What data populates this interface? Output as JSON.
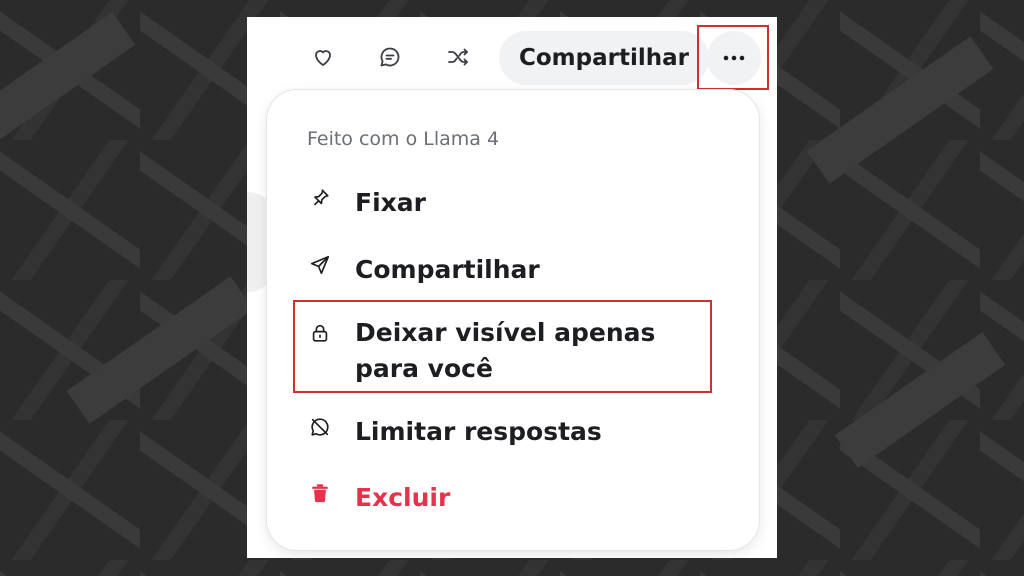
{
  "toolbar": {
    "icons": [
      "heart-icon",
      "comment-icon",
      "shuffle-icon"
    ],
    "share_label": "Compartilhar",
    "more_icon": "ellipsis-icon"
  },
  "menu": {
    "caption": "Feito com o Llama 4",
    "items": [
      {
        "label": "Fixar",
        "icon": "pin-icon"
      },
      {
        "label": "Compartilhar",
        "icon": "send-icon"
      },
      {
        "label": "Deixar visível apenas para você",
        "icon": "lock-icon"
      },
      {
        "label": "Limitar respostas",
        "icon": "comment-off-icon"
      },
      {
        "label": "Excluir",
        "icon": "trash-icon"
      }
    ]
  },
  "colors": {
    "danger": "#e5334b",
    "highlight": "#d0302e",
    "pill_bg": "#f1f2f4",
    "text": "#1c1e21",
    "muted": "#6b6f76"
  }
}
